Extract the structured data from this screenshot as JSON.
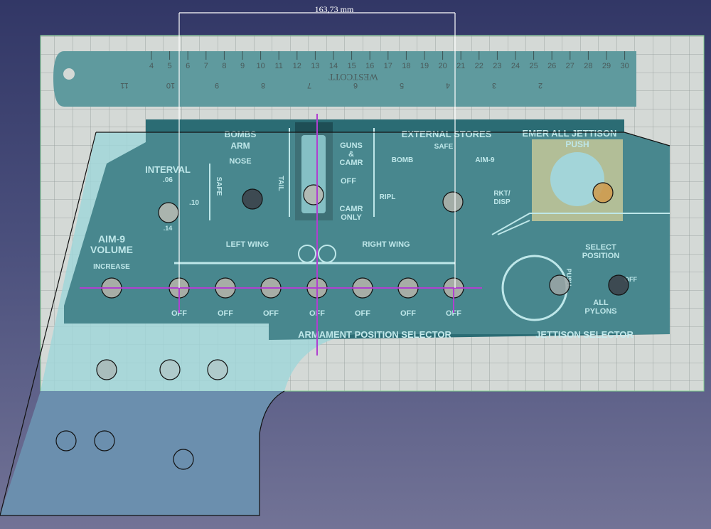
{
  "dimension": {
    "label": "163,73 mm"
  },
  "ruler": {
    "brand": "WESTCOTT",
    "cm_ticks": [
      "4",
      "5",
      "6",
      "7",
      "8",
      "9",
      "10",
      "11",
      "12",
      "13",
      "14",
      "15",
      "16",
      "17",
      "18",
      "19",
      "20",
      "21",
      "22",
      "23",
      "24",
      "25",
      "26",
      "27",
      "28",
      "29",
      "30"
    ],
    "inch_ticks": [
      "11",
      "10",
      "9",
      "8",
      "7",
      "6",
      "5",
      "4",
      "3",
      "2"
    ]
  },
  "panel": {
    "bombs_arm": "BOMBS",
    "bombs_arm2": "ARM",
    "nose": "NOSE",
    "safe": "SAFE",
    "tail": "TAIL",
    "interval": "INTERVAL",
    "interval_06": ".06",
    "interval_10": ".10",
    "interval_14": ".14",
    "guns": "GUNS",
    "amp": "&",
    "camr": "CAMR",
    "off": "OFF",
    "camr_only1": "CAMR",
    "camr_only2": "ONLY",
    "external_stores": "EXTERNAL STORES",
    "ext_safe": "SAFE",
    "bomb": "BOMB",
    "aim9": "AIM-9",
    "ripl": "RIPL",
    "rkt_disp1": "RKT/",
    "rkt_disp2": "DISP",
    "emer": "EMER ALL JETTISON",
    "push": "PUSH",
    "aim9_volume1": "AIM-9",
    "aim9_volume2": "VOLUME",
    "increase": "INCREASE",
    "left_wing": "LEFT WING",
    "right_wing": "RIGHT WING",
    "station_off": [
      "OFF",
      "OFF",
      "OFF",
      "OFF",
      "OFF",
      "OFF",
      "OFF"
    ],
    "armament_selector": "ARMAMENT POSITION SELECTOR",
    "select_position1": "SELECT",
    "select_position2": "POSITION",
    "all_pylons1": "ALL",
    "all_pylons2": "PYLONS",
    "jettison_off": "OFF",
    "push_vertical": "PUSH",
    "jettison_selector": "JETTISON SELECTOR"
  },
  "colors": {
    "sketch_face": "#9fd3d6",
    "constraint": "#b040d0",
    "panel": "#2b6c74"
  }
}
